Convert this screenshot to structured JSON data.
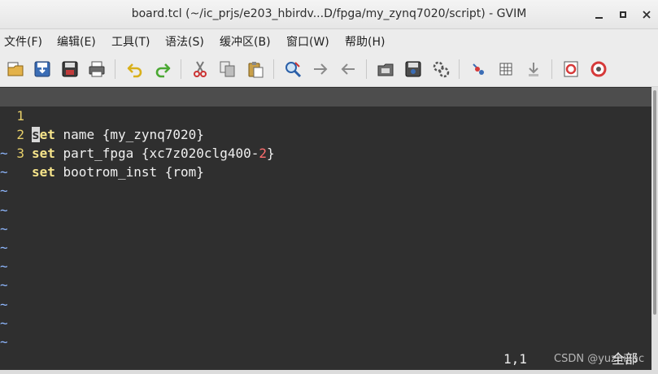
{
  "window": {
    "title": "board.tcl (~/ic_prjs/e203_hbirdv...D/fpga/my_zynq7020/script) - GVIM"
  },
  "menu": [
    {
      "label": "文件(F)"
    },
    {
      "label": "编辑(E)"
    },
    {
      "label": "工具(T)"
    },
    {
      "label": "语法(S)"
    },
    {
      "label": "缓冲区(B)"
    },
    {
      "label": "窗口(W)"
    },
    {
      "label": "帮助(H)"
    }
  ],
  "toolbar": [
    {
      "icon": "open-folder-icon"
    },
    {
      "icon": "save-download-icon"
    },
    {
      "icon": "save-all-icon"
    },
    {
      "icon": "print-icon"
    },
    {
      "icon": "undo-icon"
    },
    {
      "icon": "redo-icon"
    },
    {
      "icon": "cut-icon"
    },
    {
      "icon": "copy-icon"
    },
    {
      "icon": "paste-icon"
    },
    {
      "icon": "find-replace-icon"
    },
    {
      "icon": "find-next-icon"
    },
    {
      "icon": "find-previous-icon"
    },
    {
      "icon": "load-session-icon"
    },
    {
      "icon": "save-session-icon"
    },
    {
      "icon": "run-script-icon"
    },
    {
      "icon": "make-icon"
    },
    {
      "icon": "shell-table-icon"
    },
    {
      "icon": "tag-jump-icon"
    },
    {
      "icon": "help-icon"
    },
    {
      "icon": "find-help-icon"
    }
  ],
  "editor": {
    "lines": [
      {
        "number": "1",
        "cursor_char": "s",
        "keyword_rest": "et",
        "text": " name {my_zynq7020}",
        "number_part": ""
      },
      {
        "number": "2",
        "keyword": "set",
        "text_before": " part_fpga {xc7z020clg400-",
        "number_part": "2",
        "text_after": "}"
      },
      {
        "number": "3",
        "keyword": "set",
        "text": " bootrom_inst {rom}"
      }
    ],
    "tilde": "~",
    "tilde_count": 11
  },
  "status": {
    "ruler": "1,1",
    "percent": "全部"
  },
  "watermark": "CSDN @yuzhijiac",
  "colors": {
    "editor_bg": "#2f2f2f",
    "cursorline_bg": "#4d4d4d",
    "line_number": "#e8d06a",
    "keyword": "#f6e48a",
    "number": "#ff6e6e",
    "tilde": "#8fb8ff"
  }
}
